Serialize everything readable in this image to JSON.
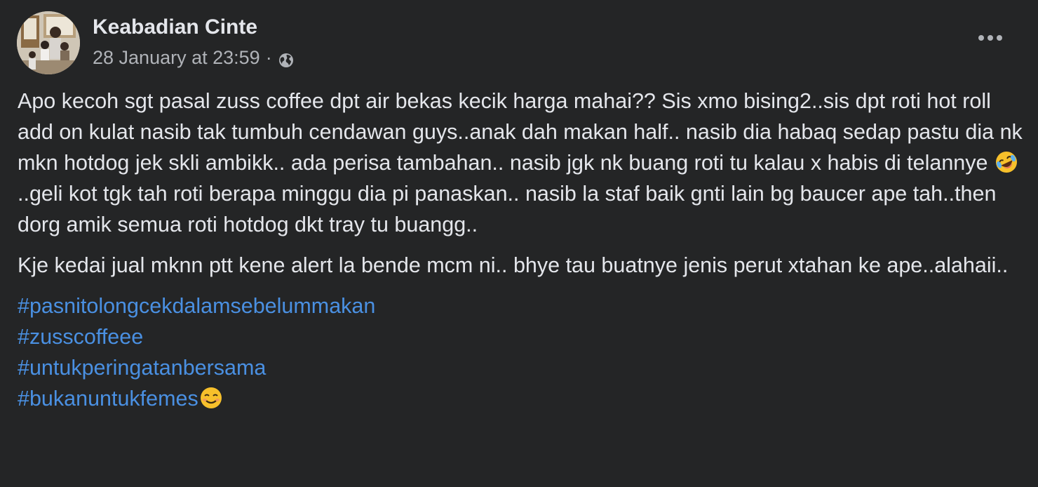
{
  "post": {
    "author_name": "Keabadian Cinte",
    "timestamp": "28 January at 23:59",
    "separator": "·",
    "audience_icon": "globe-icon",
    "menu_icon": "more-options-icon",
    "paragraph1_part1": "Apo kecoh sgt pasal zuss coffee dpt air bekas kecik harga mahai?? Sis xmo bising2..sis dpt roti hot roll add on kulat nasib tak tumbuh cendawan guys..anak dah makan half.. nasib dia habaq sedap pastu dia nk mkn hotdog jek skli ambikk.. ada perisa tambahan.. nasib jgk nk buang roti tu kalau x habis di telannye ",
    "paragraph1_emoji": "rolling-on-floor-laughing-emoji",
    "paragraph1_part2": "..geli kot tgk tah roti berapa minggu dia pi panaskan.. nasib la staf baik gnti lain bg baucer ape tah..then dorg amik semua roti hotdog dkt tray tu buangg..",
    "paragraph2": "Kje kedai jual mknn ptt kene alert la bende mcm ni.. bhye tau buatnye jenis perut xtahan ke ape..alahaii..",
    "hashtags": [
      "#pasnitolongcekdalamsebelummakan",
      "#zusscoffeee",
      "#untukperingatanbersama",
      "#bukanuntukfemes"
    ],
    "last_hashtag_emoji": "smiling-face-emoji"
  }
}
